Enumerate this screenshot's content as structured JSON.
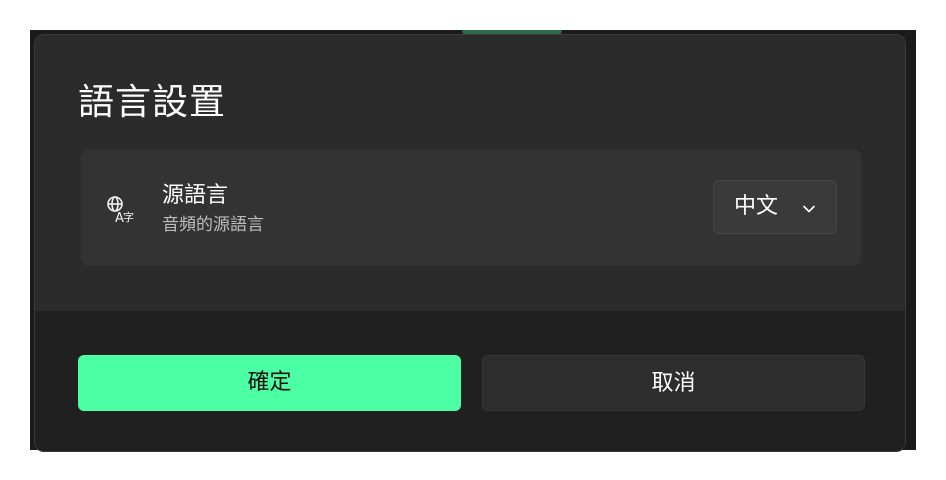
{
  "dialog": {
    "title": "語言設置"
  },
  "setting": {
    "icon": "language-translate-icon",
    "label": "源語言",
    "description": "音頻的源語言",
    "selected_language": "中文",
    "dropdown_icon": "chevron-down-icon"
  },
  "buttons": {
    "confirm_label": "確定",
    "cancel_label": "取消"
  },
  "colors": {
    "accent": "#4cffa4",
    "dialog_bg": "#2b2b2b",
    "footer_bg": "#202020",
    "card_bg": "#333333"
  }
}
